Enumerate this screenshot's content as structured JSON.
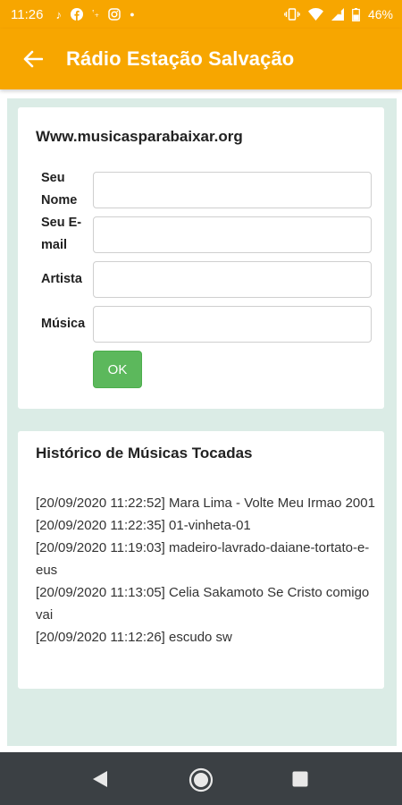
{
  "status_bar": {
    "time": "11:26",
    "battery": "46%",
    "left_icons": [
      "music-note-icon",
      "facebook-icon",
      "vpn-icon",
      "instagram-icon",
      "dot-icon"
    ],
    "right_icons": [
      "vibrate-icon",
      "wifi-icon",
      "signal-icon",
      "battery-icon"
    ]
  },
  "app_bar": {
    "title": "Rádio Estação Salvação",
    "back_icon": "arrow-left-icon",
    "color": "#f7a600"
  },
  "form_card": {
    "title": "Www.musicasparabaixar.org",
    "fields": [
      {
        "label": "Seu Nome",
        "value": "",
        "placeholder": ""
      },
      {
        "label": "Seu E-mail",
        "value": "",
        "placeholder": ""
      },
      {
        "label": "Artista",
        "value": "",
        "placeholder": ""
      },
      {
        "label": "Música",
        "value": "",
        "placeholder": ""
      }
    ],
    "submit_label": "OK",
    "submit_color": "#5cb85c"
  },
  "history_card": {
    "title": "Histórico de Músicas Tocadas",
    "items": [
      "[20/09/2020 11:22:52] Mara Lima - Volte Meu Irmao 2001",
      "[20/09/2020 11:22:35] 01-vinheta-01",
      "[20/09/2020 11:19:03] madeiro-lavrado-daiane-tortato-e-eus",
      "[20/09/2020 11:13:05] Celia Sakamoto Se Cristo comigo vai",
      "[20/09/2020 11:12:26] escudo sw"
    ]
  },
  "nav_bar": {
    "buttons": [
      "back-triangle-icon",
      "home-circle-icon",
      "recents-square-icon"
    ]
  }
}
